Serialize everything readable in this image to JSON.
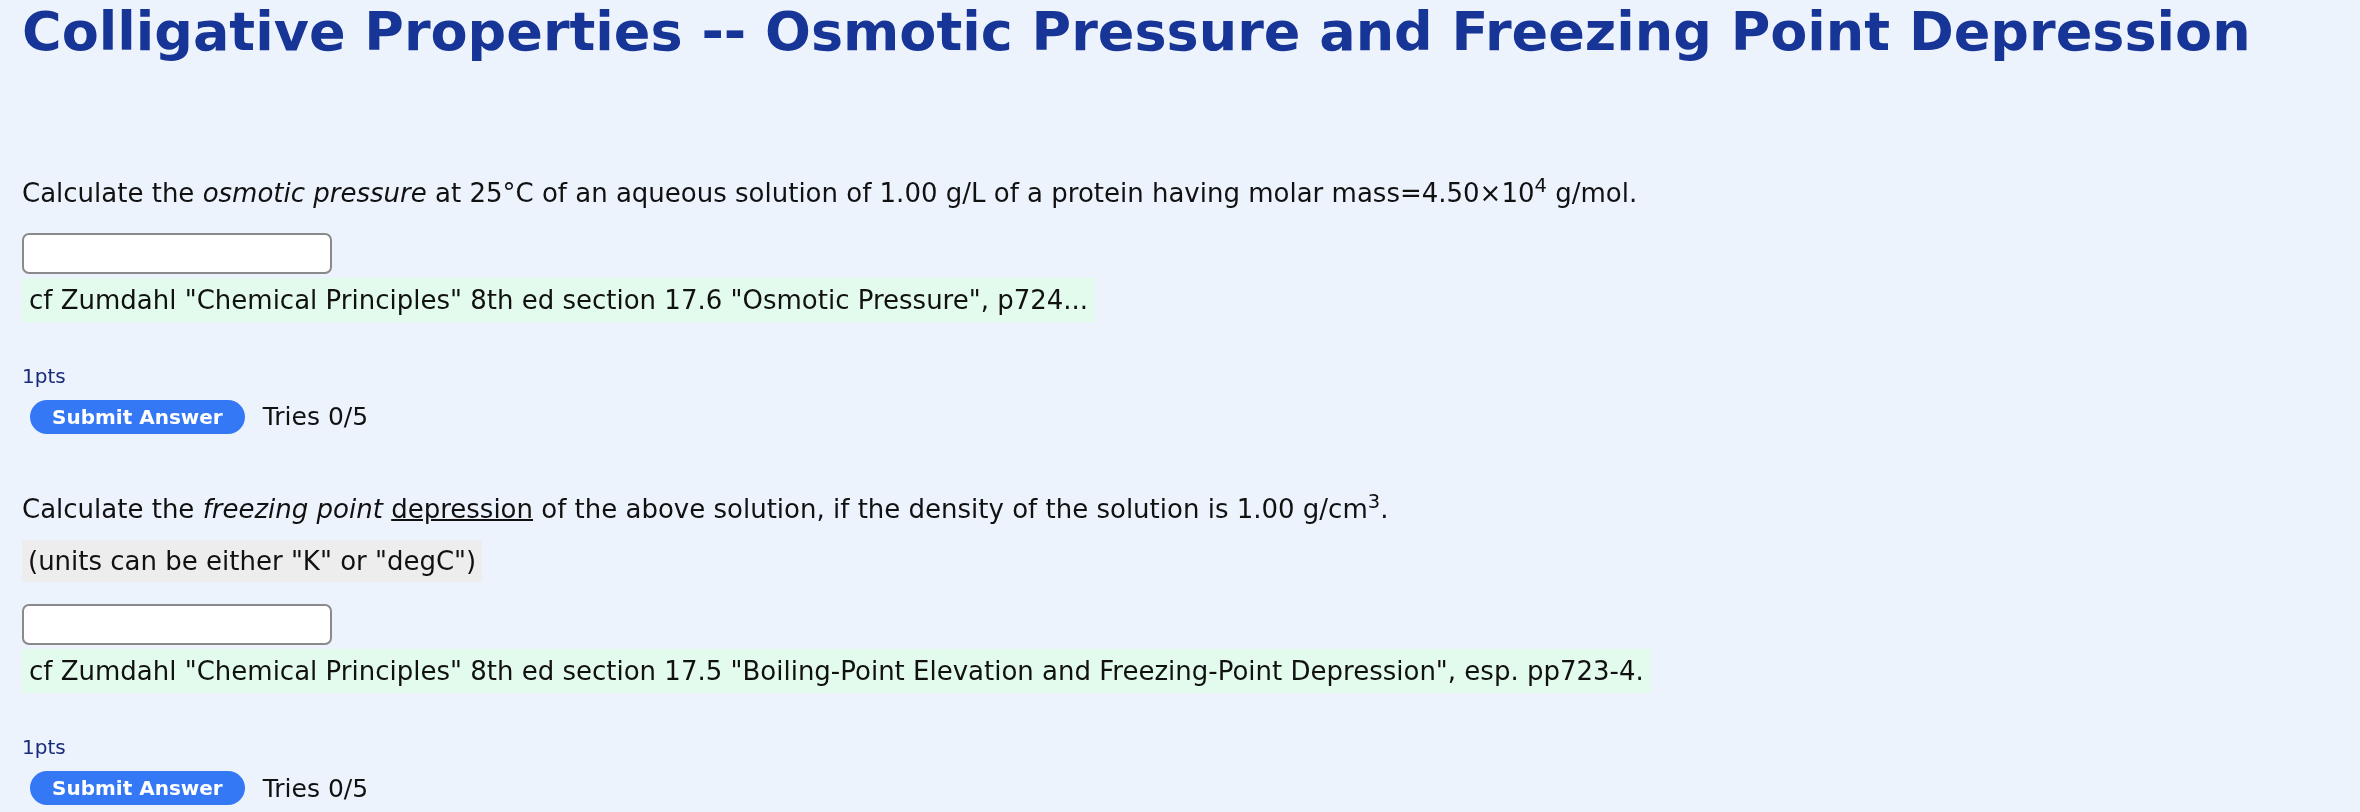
{
  "title": "Colligative Properties -- Osmotic Pressure and Freezing Point Depression",
  "questions": [
    {
      "prompt": [
        {
          "kind": "plain",
          "text": "Calculate the "
        },
        {
          "kind": "italic",
          "text": "osmotic pressure"
        },
        {
          "kind": "plain",
          "text": " at 25°C of an aqueous solution of 1.00 g/L of a protein having molar mass=4.50×10"
        },
        {
          "kind": "sup",
          "text": "4"
        },
        {
          "kind": "plain",
          "text": " g/mol."
        }
      ],
      "hint": "cf Zumdahl \"Chemical Principles\" 8th ed section 17.6 \"Osmotic Pressure\", p724...",
      "points": "1pts",
      "button": "Submit Answer",
      "tries": "Tries 0/5"
    },
    {
      "prompt": [
        {
          "kind": "plain",
          "text": "Calculate the "
        },
        {
          "kind": "italic",
          "text": "freezing point "
        },
        {
          "kind": "underline",
          "text": "depression"
        },
        {
          "kind": "plain",
          "text": " of the above solution, if the density of the solution is 1.00 g/cm"
        },
        {
          "kind": "sup",
          "text": "3"
        },
        {
          "kind": "plain",
          "text": "."
        }
      ],
      "note": "(units can be either \"K\" or \"degC\")",
      "hint": "cf Zumdahl \"Chemical Principles\" 8th ed section 17.5 \"Boiling-Point Elevation and Freezing-Point Depression\", esp. pp723-4.",
      "points": "1pts",
      "button": "Submit Answer",
      "tries": "Tries 0/5"
    }
  ]
}
